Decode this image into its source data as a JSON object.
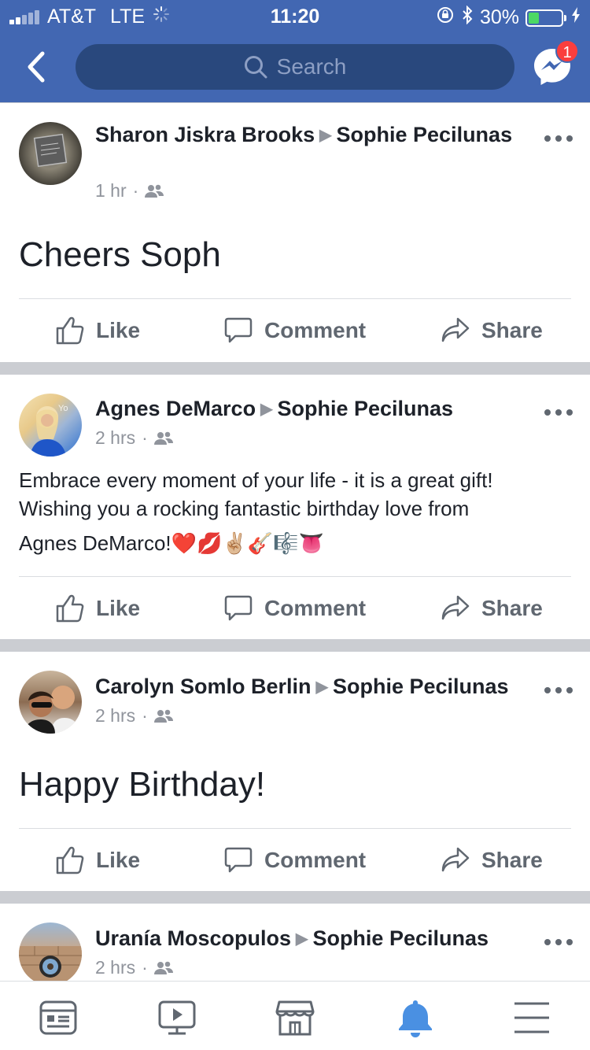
{
  "status_bar": {
    "carrier": "AT&T",
    "network": "LTE",
    "time": "11:20",
    "battery": "30%",
    "battery_level": 0.3
  },
  "header": {
    "search_placeholder": "Search",
    "messenger_badge": "1",
    "icons": [
      "back-chevron-icon",
      "search-icon",
      "messenger-icon"
    ]
  },
  "posts": [
    {
      "author": "Sharon Jiskra Brooks",
      "target": "Sophie Pecilunas",
      "time": "1 hr",
      "text": "Cheers Soph"
    },
    {
      "author": "Agnes DeMarco",
      "target": "Sophie Pecilunas",
      "time": "2 hrs",
      "text_line1": "Embrace every moment of your life - it is a great gift!",
      "text_line2": "Wishing you  a rocking fantastic birthday love from",
      "text_line3": "Agnes DeMarco!",
      "emojis": "❤️💋✌🏼🎸🎼👅"
    },
    {
      "author": "Carolyn Somlo Berlin",
      "target": "Sophie Pecilunas",
      "time": "2 hrs",
      "text": "Happy Birthday!"
    },
    {
      "author": "Uranía Moscopulos",
      "target": "Sophie Pecilunas",
      "time": "2 hrs"
    }
  ],
  "actions": {
    "like": "Like",
    "comment": "Comment",
    "share": "Share"
  },
  "tabbar": {
    "tabs": [
      "news-feed-icon",
      "video-icon",
      "marketplace-icon",
      "notifications-icon",
      "menu-icon"
    ],
    "active": "notifications-icon",
    "active_color": "#4a90e2"
  },
  "colors": {
    "brand": "#4267b2",
    "search_bg": "#29487d",
    "badge": "#fa3e3e"
  }
}
